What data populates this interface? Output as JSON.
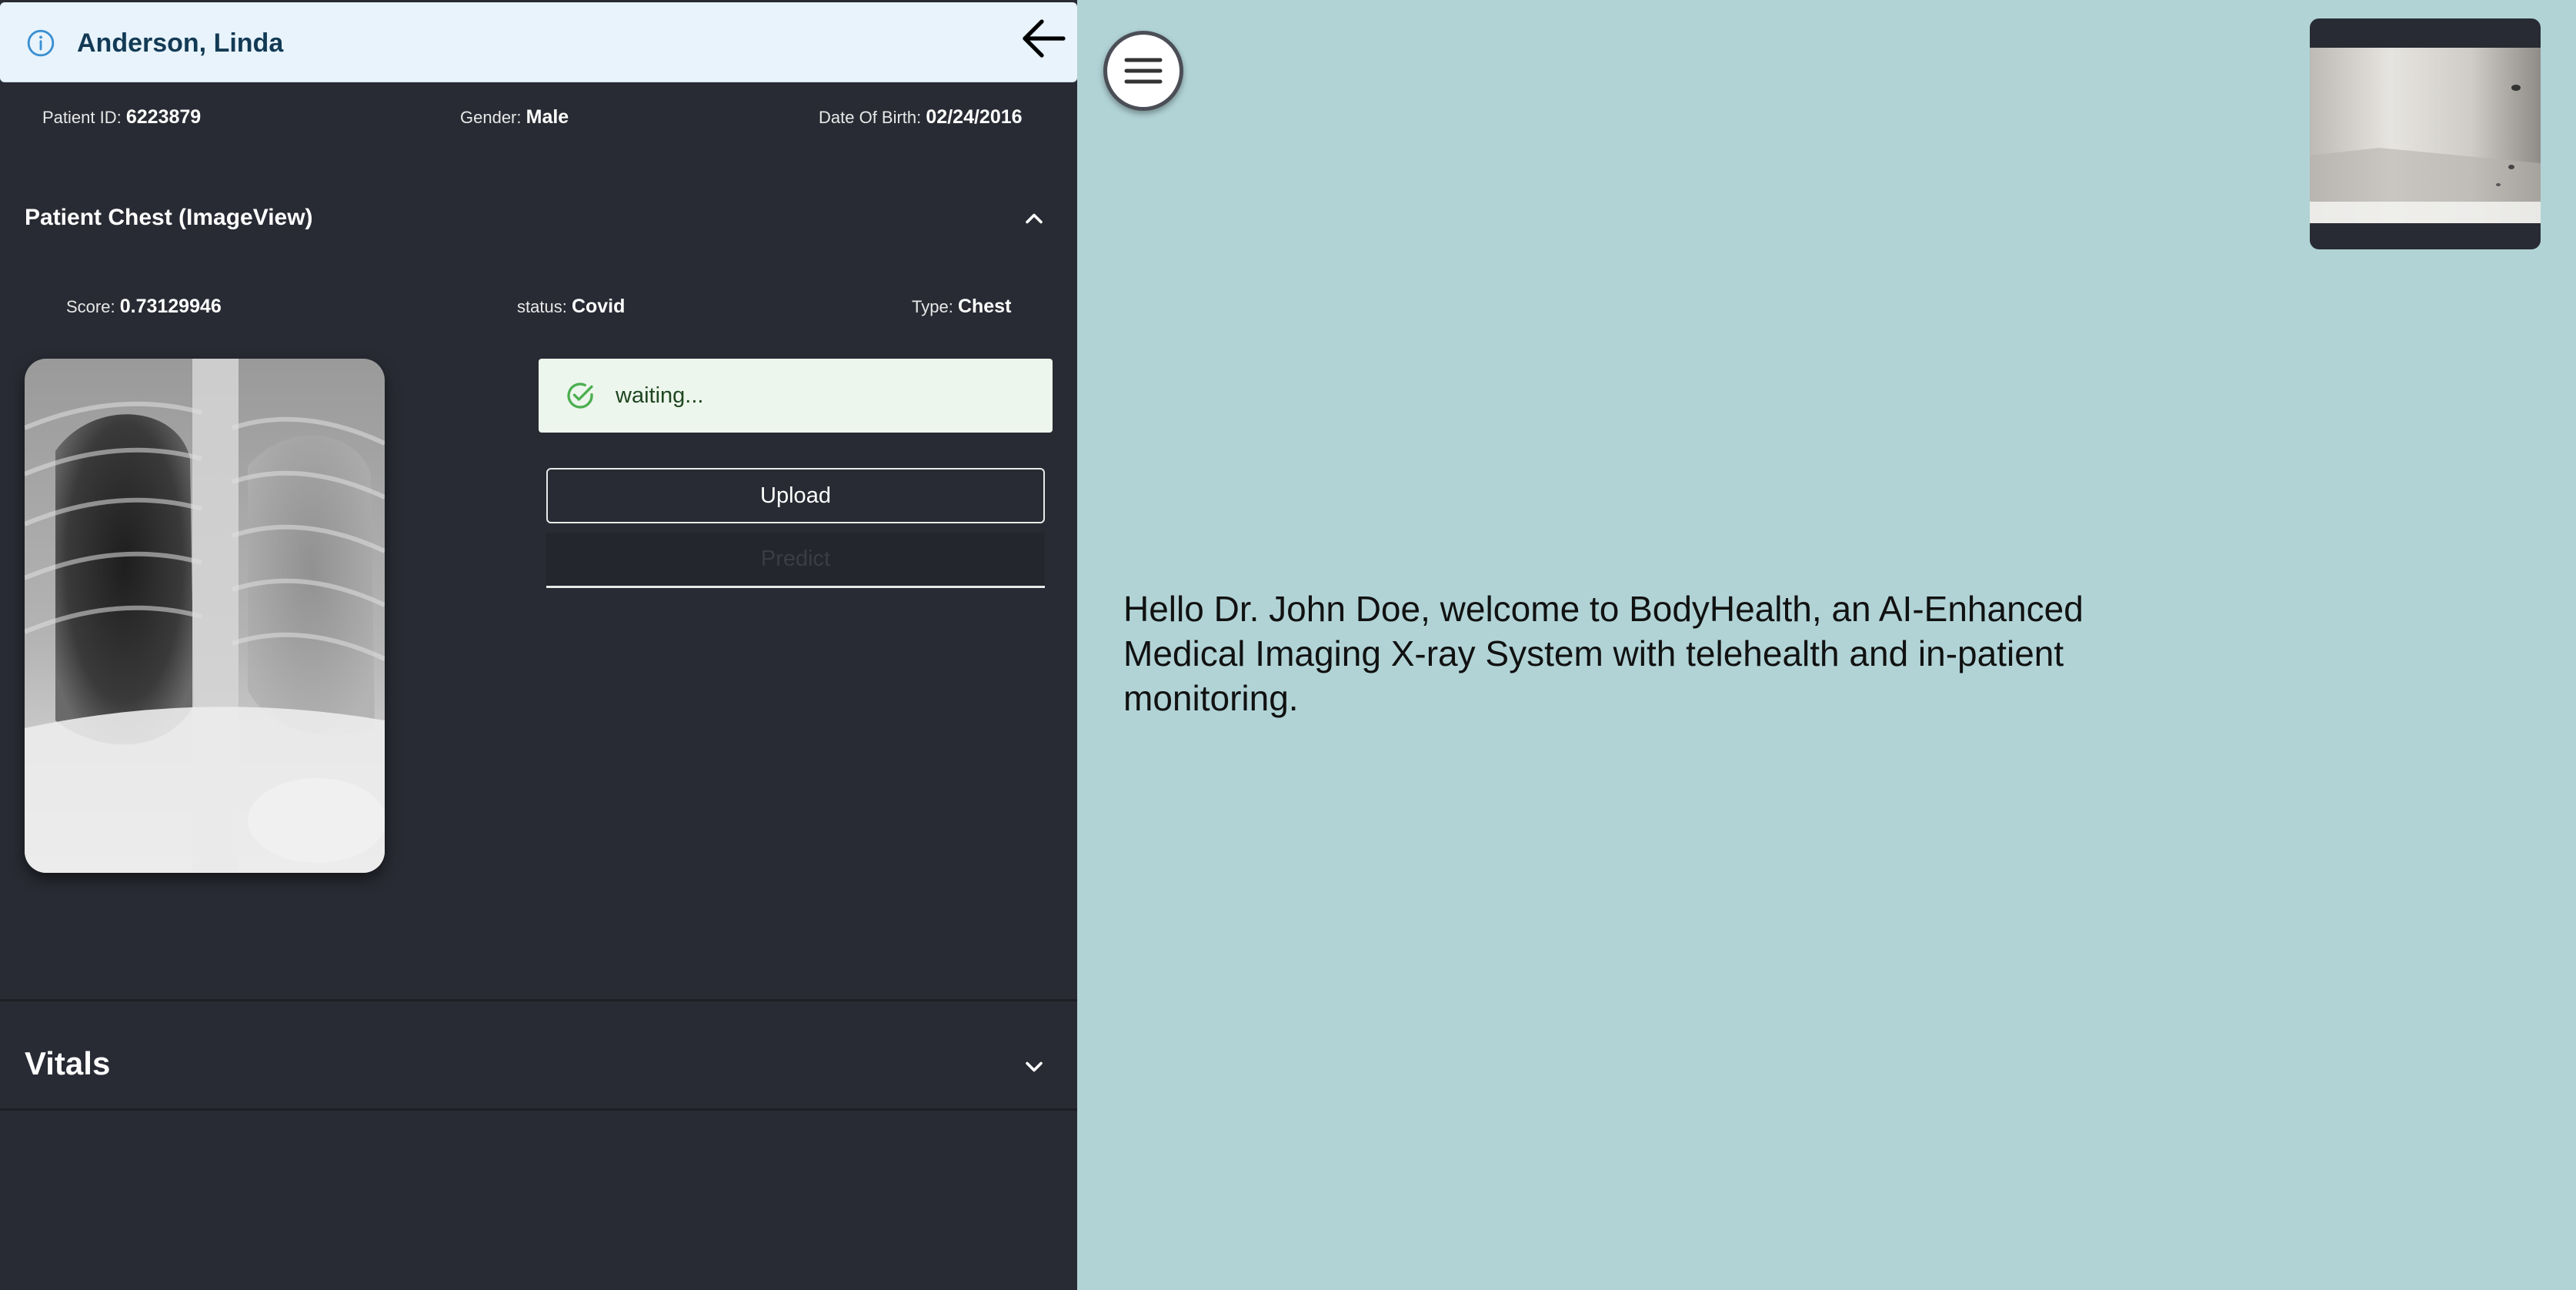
{
  "patient": {
    "name": "Anderson, Linda",
    "id_label": "Patient ID:",
    "id_value": "6223879",
    "gender_label": "Gender:",
    "gender_value": "Male",
    "dob_label": "Date Of Birth:",
    "dob_value": "02/24/2016"
  },
  "image_section": {
    "title": "Patient Chest (ImageView)",
    "score_label": "Score:",
    "score_value": "0.73129946",
    "status_label": "status:",
    "status_value": "Covid",
    "type_label": "Type:",
    "type_value": "Chest",
    "alert_text": "waiting...",
    "upload_label": "Upload",
    "predict_label": "Predict"
  },
  "vitals_section": {
    "title": "Vitals"
  },
  "main": {
    "welcome_text": "Hello Dr. John Doe, welcome to BodyHealth, an AI-Enhanced Medical Imaging X-ray System with telehealth and in-patient monitoring."
  },
  "icons": {
    "info": "info-icon",
    "back": "arrow-left-icon",
    "collapse": "chevron-up-icon",
    "expand": "chevron-down-icon",
    "success": "check-circle-icon",
    "menu": "hamburger-menu-icon"
  },
  "colors": {
    "panel_bg": "#282b33",
    "main_bg": "#b1d3d6",
    "header_bg": "#e8f3fc",
    "alert_bg": "#edf6ec",
    "success": "#4caf50"
  }
}
